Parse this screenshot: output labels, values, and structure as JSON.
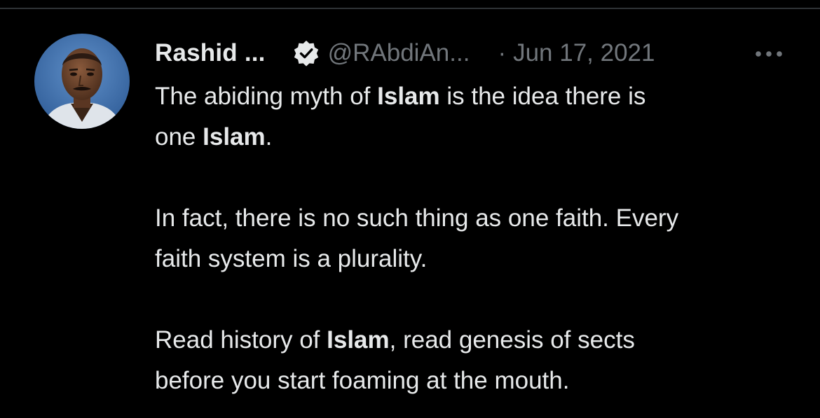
{
  "tweet": {
    "author_name": "Rashid ...",
    "handle": "@RAbdiAn...",
    "separator": "·",
    "date": "Jun 17, 2021",
    "verified_icon": "verified-badge-icon",
    "more_icon": "more-horizontal-icon",
    "paragraphs": [
      {
        "lines": [
          [
            {
              "text": "The abiding myth of ",
              "bold": false
            },
            {
              "text": "Islam",
              "bold": true
            },
            {
              "text": " is the idea there is",
              "bold": false
            }
          ],
          [
            {
              "text": "one ",
              "bold": false
            },
            {
              "text": "Islam",
              "bold": true
            },
            {
              "text": ".",
              "bold": false
            }
          ]
        ]
      },
      {
        "lines": [
          [
            {
              "text": "In fact, there is no such thing as one faith. Every",
              "bold": false
            }
          ],
          [
            {
              "text": "faith system is a plurality.",
              "bold": false
            }
          ]
        ]
      },
      {
        "lines": [
          [
            {
              "text": "Read history of ",
              "bold": false
            },
            {
              "text": "Islam",
              "bold": true
            },
            {
              "text": ", read genesis of sects",
              "bold": false
            }
          ],
          [
            {
              "text": "before you start foaming at the mouth.",
              "bold": false
            }
          ]
        ]
      }
    ]
  },
  "colors": {
    "background": "#000000",
    "text": "#e7e9ea",
    "muted": "#71767b",
    "divider": "#2f3336"
  }
}
